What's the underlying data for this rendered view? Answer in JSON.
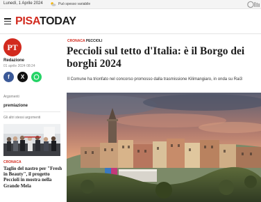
{
  "topbar": {
    "date": "Lunedì, 1 Aprile 2024",
    "weather": "Può spesso variabile"
  },
  "header": {
    "brand_part1": "PISA",
    "brand_part2": "TODAY"
  },
  "author": {
    "initials": "PT",
    "name": "Redazione",
    "published": "01 aprile 2024 08:24"
  },
  "share": {
    "facebook_glyph": "f",
    "x_glyph": "X"
  },
  "sidebar": {
    "topics_label": "Argomenti",
    "topic": "premiazione",
    "related_label": "Gli altri stessi argomenti",
    "related_category": "CRONACA",
    "related_title": "Taglio del nastro per \"Fresh in Beauty\", il progetto Peccioli in mostra nella Grande Mela"
  },
  "article": {
    "category": "CRONACA",
    "location": "PECCIOLI",
    "headline": "Peccioli sul tetto d'Italia: è il Borgo dei borghi 2024",
    "summary": "Il Comune ha trionfato nel concorso promosso dalla trasmissione Kilimangiaro, in onda su Rai3"
  },
  "colors": {
    "brand_red": "#d22a1e",
    "facebook": "#3b5998",
    "whatsapp": "#25d366"
  },
  "icons": [
    "weather-icon",
    "city-logo-icon",
    "menu-icon",
    "facebook-icon",
    "x-icon",
    "whatsapp-icon"
  ]
}
